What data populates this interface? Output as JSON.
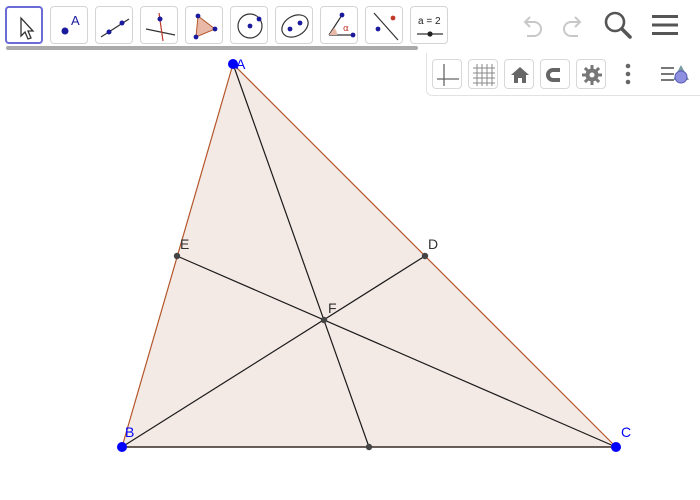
{
  "toolbar": {
    "tools": [
      {
        "name": "move-tool",
        "icon": "cursor-arrow-icon",
        "active": true
      },
      {
        "name": "point-tool",
        "icon": "point-icon",
        "label": "A"
      },
      {
        "name": "line-tool",
        "icon": "line-through-points-icon"
      },
      {
        "name": "perpendicular-line-tool",
        "icon": "perpendicular-line-icon"
      },
      {
        "name": "polygon-tool",
        "icon": "polygon-icon"
      },
      {
        "name": "circle-tool",
        "icon": "circle-center-point-icon"
      },
      {
        "name": "conic-tool",
        "icon": "ellipse-icon"
      },
      {
        "name": "angle-tool",
        "icon": "angle-icon",
        "label": "α"
      },
      {
        "name": "reflect-tool",
        "icon": "reflect-about-line-icon"
      },
      {
        "name": "slider-tool",
        "icon": "slider-icon",
        "label": "a = 2"
      }
    ],
    "right_icons": [
      "undo-icon",
      "redo-icon",
      "search-icon",
      "menu-icon"
    ]
  },
  "style_bar": {
    "buttons": [
      "axes-icon",
      "grid-icon",
      "home-icon",
      "magnet-icon",
      "gear-icon",
      "more-vertical-icon",
      "style-bar-toggle-icon"
    ]
  },
  "construction": {
    "points": {
      "A": {
        "label": "A"
      },
      "B": {
        "label": "B"
      },
      "C": {
        "label": "C"
      },
      "D": {
        "label": "D"
      },
      "E": {
        "label": "E"
      },
      "F": {
        "label": "F"
      }
    },
    "colors": {
      "triangle_fill": "#f3e9e5",
      "triangle_edge": "#b5562a",
      "free_point": "#0000ff",
      "dependent_point": "#444444",
      "free_label": "#0000ff",
      "dependent_label": "#333333",
      "cevian": "#1a1a1a"
    }
  }
}
